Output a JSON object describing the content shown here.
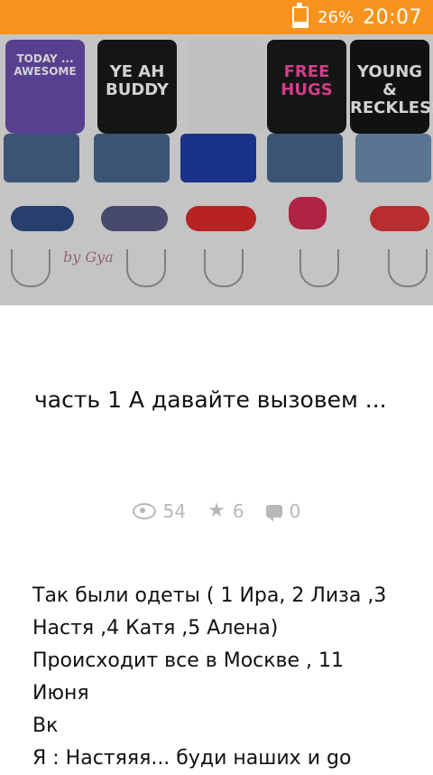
{
  "status_bar": {
    "battery_percent": "26%",
    "time": "20:07",
    "battery_level": 0.26
  },
  "hero": {
    "shirts": [
      "TODAY ... AWESOME",
      "YE AH BUDDY",
      "",
      "FREE HUGS",
      "YOUNG & RECKLESS"
    ],
    "signature": "by Gya"
  },
  "article": {
    "title": "часть 1 А давайте вызовем ...",
    "stats": {
      "views": "54",
      "likes": "6",
      "comments": "0"
    },
    "body_lines": [
      "Так были одеты ( 1 Ира, 2 Лиза ,3",
      "Настя ,4 Катя ,5 Алена)",
      "Происходит все в Москве , 11",
      "Июня",
      "Вк",
      "Я : Настяяя... буди наших и go"
    ]
  }
}
